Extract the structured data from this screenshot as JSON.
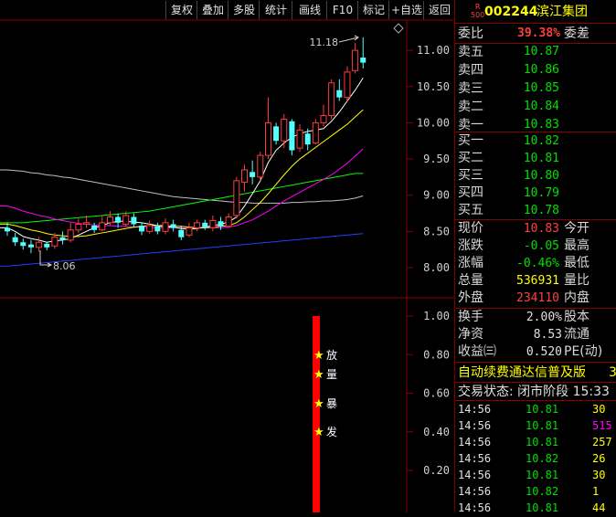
{
  "toolbar": [
    "复权",
    "叠加",
    "多股",
    "统计",
    "画线",
    "F10",
    "标记",
    "+自选",
    "返回"
  ],
  "stock": {
    "badge_top": "R",
    "badge_bottom": "500",
    "code": "002244",
    "name": "滨江集团"
  },
  "weibi": {
    "label": "委比",
    "value": "39.38%",
    "label2": "委差"
  },
  "sell": [
    {
      "label": "卖五",
      "price": "10.87"
    },
    {
      "label": "卖四",
      "price": "10.86"
    },
    {
      "label": "卖三",
      "price": "10.85"
    },
    {
      "label": "卖二",
      "price": "10.84"
    },
    {
      "label": "卖一",
      "price": "10.83"
    }
  ],
  "buy": [
    {
      "label": "买一",
      "price": "10.82"
    },
    {
      "label": "买二",
      "price": "10.81"
    },
    {
      "label": "买三",
      "price": "10.80"
    },
    {
      "label": "买四",
      "price": "10.79"
    },
    {
      "label": "买五",
      "price": "10.78"
    }
  ],
  "quote": [
    {
      "label": "现价",
      "value": "10.83",
      "label2": "今开",
      "color": "#ff4040"
    },
    {
      "label": "涨跌",
      "value": "-0.05",
      "label2": "最高",
      "color": "#00e000"
    },
    {
      "label": "涨幅",
      "value": "-0.46%",
      "label2": "最低",
      "color": "#00e000"
    },
    {
      "label": "总量",
      "value": "536931",
      "label2": "量比",
      "color": "#ffff00"
    },
    {
      "label": "外盘",
      "value": "234110",
      "label2": "内盘",
      "color": "#ff4040"
    }
  ],
  "stats": [
    {
      "label": "换手",
      "value": "2.00%",
      "label2": "股本"
    },
    {
      "label": "净资",
      "value": "8.53",
      "label2": "流通"
    },
    {
      "label": "收益㈢",
      "value": "0.520",
      "label2": "PE(动)"
    }
  ],
  "banner": "自动续费通达信普及版",
  "banner_tail": "3",
  "trade_status": "交易状态: 闭市阶段 15:33",
  "ticks": [
    {
      "time": "14:56",
      "price": "10.81",
      "vol": "30",
      "color": "#ffff00"
    },
    {
      "time": "14:56",
      "price": "10.81",
      "vol": "515",
      "color": "#ff00ff"
    },
    {
      "time": "14:56",
      "price": "10.81",
      "vol": "257",
      "color": "#ffff00"
    },
    {
      "time": "14:56",
      "price": "10.82",
      "vol": "26",
      "color": "#ffff00"
    },
    {
      "time": "14:56",
      "price": "10.81",
      "vol": "30",
      "color": "#ffff00"
    },
    {
      "time": "14:56",
      "price": "10.82",
      "vol": "1",
      "color": "#ffff00"
    },
    {
      "time": "14:56",
      "price": "10.81",
      "vol": "44",
      "color": "#ffff00"
    }
  ],
  "chart_data": {
    "type": "candlestick",
    "y_ticks": [
      "11.00",
      "10.50",
      "10.00",
      "9.50",
      "9.00",
      "8.50",
      "8.00"
    ],
    "y_range": [
      7.75,
      11.45
    ],
    "annot_high": "11.18",
    "annot_low": "8.06",
    "candles": [
      [
        8.55,
        8.5,
        8.62,
        8.44
      ],
      [
        8.42,
        8.35,
        8.48,
        8.3
      ],
      [
        8.35,
        8.3,
        8.4,
        8.25
      ],
      [
        8.32,
        8.28,
        8.38,
        8.2
      ],
      [
        8.28,
        8.35,
        8.42,
        8.22
      ],
      [
        8.33,
        8.28,
        8.36,
        8.24
      ],
      [
        8.3,
        8.42,
        8.48,
        8.26
      ],
      [
        8.42,
        8.38,
        8.5,
        8.32
      ],
      [
        8.38,
        8.52,
        8.62,
        8.35
      ],
      [
        8.52,
        8.6,
        8.68,
        8.48
      ],
      [
        8.6,
        8.62,
        8.72,
        8.55
      ],
      [
        8.58,
        8.52,
        8.62,
        8.48
      ],
      [
        8.52,
        8.62,
        8.72,
        8.5
      ],
      [
        8.62,
        8.7,
        8.78,
        8.58
      ],
      [
        8.7,
        8.62,
        8.75,
        8.55
      ],
      [
        8.6,
        8.72,
        8.78,
        8.56
      ],
      [
        8.7,
        8.6,
        8.75,
        8.55
      ],
      [
        8.58,
        8.5,
        8.62,
        8.45
      ],
      [
        8.5,
        8.58,
        8.65,
        8.47
      ],
      [
        8.57,
        8.5,
        8.62,
        8.46
      ],
      [
        8.5,
        8.62,
        8.68,
        8.46
      ],
      [
        8.6,
        8.55,
        8.66,
        8.5
      ],
      [
        8.52,
        8.42,
        8.58,
        8.38
      ],
      [
        8.45,
        8.55,
        8.62,
        8.42
      ],
      [
        8.55,
        8.62,
        8.66,
        8.5
      ],
      [
        8.62,
        8.55,
        8.66,
        8.52
      ],
      [
        8.55,
        8.65,
        8.72,
        8.5
      ],
      [
        8.64,
        8.57,
        8.7,
        8.52
      ],
      [
        8.57,
        8.7,
        8.75,
        8.55
      ],
      [
        8.72,
        9.2,
        9.25,
        8.68
      ],
      [
        9.18,
        9.35,
        9.42,
        9.05
      ],
      [
        9.32,
        9.25,
        9.48,
        9.15
      ],
      [
        9.25,
        9.55,
        9.6,
        9.2
      ],
      [
        9.55,
        10.0,
        10.35,
        9.5
      ],
      [
        9.95,
        9.75,
        10.0,
        9.7
      ],
      [
        9.75,
        10.05,
        10.12,
        9.65
      ],
      [
        10.02,
        9.62,
        10.05,
        9.55
      ],
      [
        9.65,
        9.9,
        9.98,
        9.6
      ],
      [
        9.85,
        9.7,
        9.92,
        9.62
      ],
      [
        9.72,
        10.0,
        10.05,
        9.7
      ],
      [
        10.0,
        10.1,
        10.25,
        9.95
      ],
      [
        10.1,
        10.55,
        10.6,
        10.05
      ],
      [
        10.45,
        10.35,
        10.6,
        10.3
      ],
      [
        10.35,
        10.7,
        10.78,
        10.3
      ],
      [
        10.72,
        11.0,
        11.1,
        10.68
      ],
      [
        10.9,
        10.83,
        11.18,
        10.75
      ]
    ],
    "ma5": [
      8.55,
      8.5,
      8.43,
      8.4,
      8.38,
      8.35,
      8.37,
      8.38,
      8.4,
      8.45,
      8.5,
      8.55,
      8.58,
      8.62,
      8.64,
      8.64,
      8.63,
      8.62,
      8.6,
      8.58,
      8.56,
      8.56,
      8.54,
      8.53,
      8.54,
      8.56,
      8.58,
      8.6,
      8.63,
      8.7,
      8.85,
      9.02,
      9.2,
      9.45,
      9.62,
      9.72,
      9.8,
      9.85,
      9.88,
      9.9,
      9.92,
      10.02,
      10.15,
      10.3,
      10.45,
      10.62
    ],
    "ma10": [
      8.6,
      8.58,
      8.55,
      8.52,
      8.5,
      8.47,
      8.45,
      8.44,
      8.43,
      8.43,
      8.44,
      8.46,
      8.48,
      8.5,
      8.52,
      8.54,
      8.56,
      8.57,
      8.58,
      8.58,
      8.58,
      8.57,
      8.57,
      8.56,
      8.55,
      8.55,
      8.56,
      8.57,
      8.58,
      8.62,
      8.7,
      8.8,
      8.9,
      9.02,
      9.15,
      9.28,
      9.4,
      9.5,
      9.58,
      9.66,
      9.74,
      9.82,
      9.9,
      9.98,
      10.08,
      10.18
    ],
    "ma20": [
      8.85,
      8.82,
      8.78,
      8.75,
      8.72,
      8.7,
      8.67,
      8.65,
      8.63,
      8.61,
      8.6,
      8.59,
      8.58,
      8.58,
      8.57,
      8.57,
      8.56,
      8.56,
      8.55,
      8.55,
      8.55,
      8.55,
      8.55,
      8.55,
      8.55,
      8.55,
      8.55,
      8.55,
      8.56,
      8.58,
      8.62,
      8.66,
      8.72,
      8.78,
      8.85,
      8.92,
      8.98,
      9.04,
      9.1,
      9.16,
      9.22,
      9.28,
      9.36,
      9.44,
      9.54,
      9.64
    ],
    "ma30": [
      8.62,
      8.62,
      8.62,
      8.63,
      8.64,
      8.65,
      8.66,
      8.67,
      8.68,
      8.69,
      8.7,
      8.71,
      8.72,
      8.73,
      8.74,
      8.75,
      8.76,
      8.77,
      8.78,
      8.8,
      8.82,
      8.84,
      8.86,
      8.88,
      8.9,
      8.92,
      8.94,
      8.96,
      8.98,
      9.0,
      9.02,
      9.04,
      9.06,
      9.08,
      9.1,
      9.12,
      9.14,
      9.16,
      9.18,
      9.2,
      9.22,
      9.24,
      9.26,
      9.28,
      9.3,
      9.3
    ],
    "ma60": [
      9.35,
      9.34,
      9.33,
      9.31,
      9.3,
      9.28,
      9.27,
      9.25,
      9.24,
      9.22,
      9.2,
      9.18,
      9.16,
      9.14,
      9.12,
      9.1,
      9.08,
      9.06,
      9.04,
      9.02,
      9.0,
      8.98,
      8.97,
      8.96,
      8.95,
      8.94,
      8.93,
      8.92,
      8.91,
      8.9,
      8.9,
      8.89,
      8.89,
      8.89,
      8.89,
      8.89,
      8.9,
      8.9,
      8.91,
      8.91,
      8.92,
      8.92,
      8.93,
      8.94,
      8.96,
      8.99
    ],
    "ma120": [
      8.02,
      8.03,
      8.04,
      8.05,
      8.06,
      8.07,
      8.08,
      8.09,
      8.1,
      8.11,
      8.12,
      8.13,
      8.14,
      8.15,
      8.16,
      8.17,
      8.18,
      8.19,
      8.2,
      8.21,
      8.22,
      8.23,
      8.24,
      8.25,
      8.26,
      8.27,
      8.28,
      8.29,
      8.3,
      8.31,
      8.32,
      8.33,
      8.34,
      8.35,
      8.36,
      8.37,
      8.38,
      8.39,
      8.4,
      8.41,
      8.42,
      8.43,
      8.44,
      8.45,
      8.46,
      8.47
    ],
    "colors": {
      "up": "#ff3c3c",
      "down": "#54ffff",
      "ma5": "#ffffff",
      "ma10": "#ffff00",
      "ma20": "#ff00ff",
      "ma30": "#00ff00",
      "ma60": "#c0c0c0",
      "ma120": "#2040ff"
    },
    "indicator": {
      "y_ticks": [
        "1.00",
        "0.80",
        "0.60",
        "0.40",
        "0.20"
      ],
      "labels": [
        "放",
        "量",
        "暴",
        "发"
      ],
      "bar_color": "#ff0000"
    }
  }
}
